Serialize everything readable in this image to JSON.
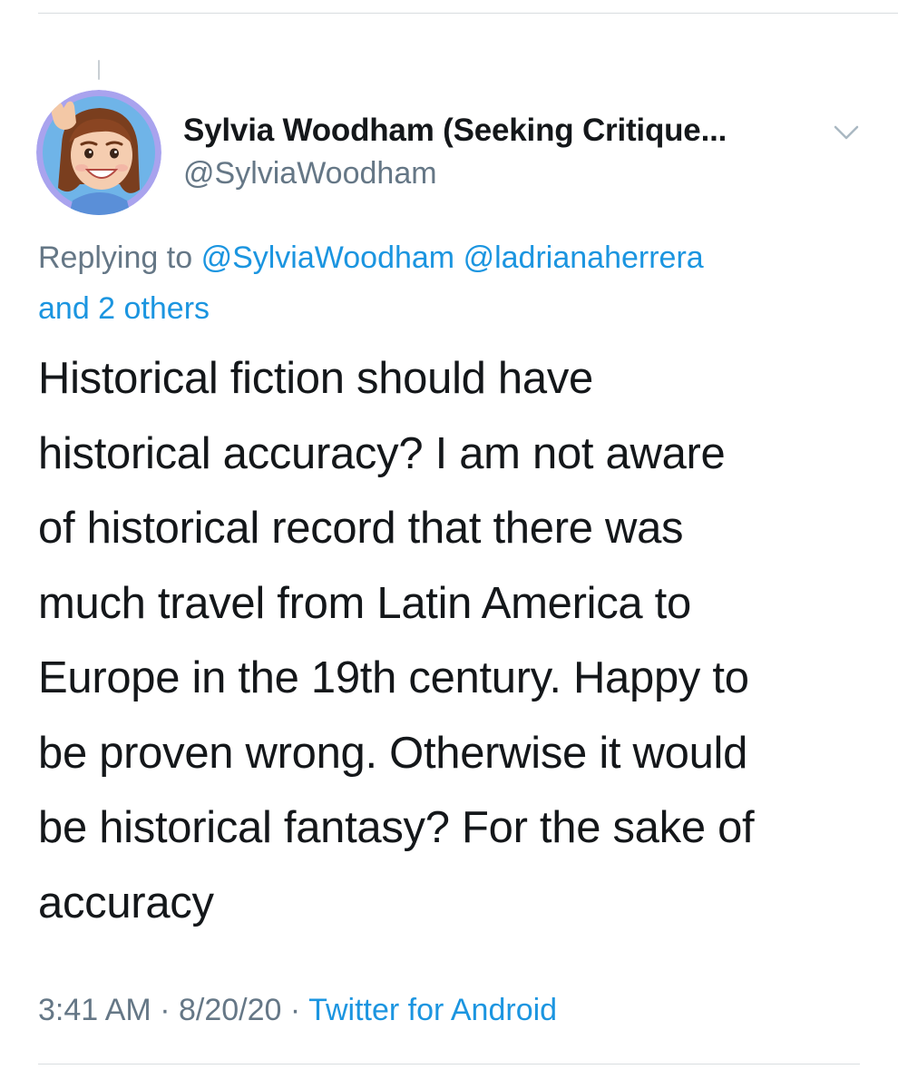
{
  "tweet": {
    "author": {
      "display_name": "Sylvia Woodham (Seeking Critique...",
      "handle": "@SylviaWoodham",
      "avatar_icon": "cartoon-avatar-waving"
    },
    "menu_icon": "chevron-down-icon",
    "replying_to": {
      "prefix": "Replying to",
      "mention_1": "@SylviaWoodham",
      "mention_2": "@ladrianaherrera",
      "others": "and 2 others"
    },
    "text_lines": [
      "Historical fiction should have",
      "historical accuracy? I am not aware",
      "of historical record that there was",
      "much travel from Latin America to",
      "Europe in the 19th century. Happy to",
      "be proven wrong. Otherwise it would",
      "be historical fantasy? For the sake of",
      "accuracy"
    ],
    "meta": {
      "time": "3:41 AM",
      "separator": "·",
      "date": "8/20/20",
      "source": "Twitter for Android"
    }
  },
  "colors": {
    "text": "#14171a",
    "secondary": "#657786",
    "link": "#1b95e0",
    "divider": "#d9dde0"
  }
}
